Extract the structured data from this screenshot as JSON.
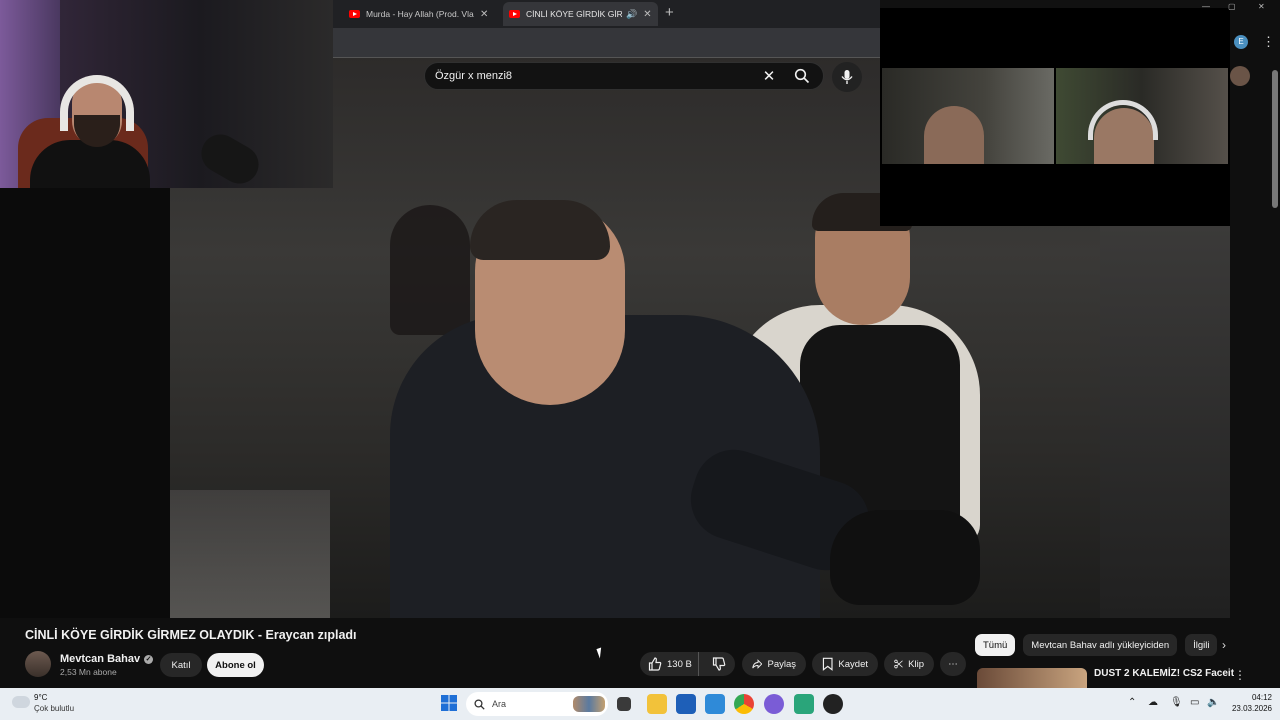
{
  "browser": {
    "tabs": [
      {
        "title": "Murda - Hay Allah (Prod. Vlado",
        "active": false
      },
      {
        "title": "CİNLİ KÖYE GİRDİK GİRMEZ",
        "active": true
      }
    ]
  },
  "search": {
    "query": "Özgür x menzi8"
  },
  "video": {
    "title": "CİNLİ KÖYE GİRDİK GİRMEZ OLAYDIK - Eraycan zıpladı"
  },
  "channel": {
    "name": "Mevtcan Bahav",
    "subscribers": "2,53 Mn abone",
    "join_label": "Katıl",
    "subscribe_label": "Abone ol"
  },
  "actions": {
    "likes": "130 B",
    "share": "Paylaş",
    "save": "Kaydet",
    "clip": "Klip"
  },
  "chips": [
    "Tümü",
    "Mevtcan Bahav adlı yükleyiciden",
    "İlgili"
  ],
  "recommendation": {
    "title": "DUST 2 KALEMİZ! CS2 Faceit"
  },
  "taskbar": {
    "weather_temp": "9°C",
    "weather_desc": "Çok bulutlu",
    "search_placeholder": "Ara",
    "time": "04:12",
    "date": "23.03.2026"
  },
  "profile_initial": "E",
  "colors": {
    "yt_red": "#ff0000",
    "bg": "#0f0f0f",
    "chip_bg": "#272727",
    "taskbar": "#e9eef3"
  }
}
